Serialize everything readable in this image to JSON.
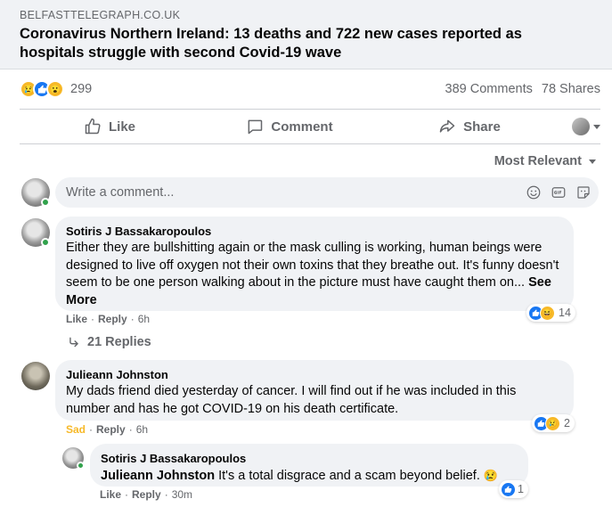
{
  "link": {
    "domain": "BELFASTTELEGRAPH.CO.UK",
    "title": "Coronavirus Northern Ireland: 13 deaths and 722 new cases reported as hospitals struggle with second Covid-19 wave"
  },
  "stats": {
    "reaction_count": "299",
    "comments": "389 Comments",
    "shares": "78 Shares"
  },
  "actions": {
    "like": "Like",
    "comment": "Comment",
    "share": "Share"
  },
  "sort": {
    "label": "Most Relevant"
  },
  "composer": {
    "placeholder": "Write a comment..."
  },
  "comments": [
    {
      "author": "Sotiris J Bassakaropoulos",
      "text": "Either they are bullshitting again or the mask culling is working, human beings were designed to live off oxygen not their own toxins that they breathe out. It's funny doesn't seem to be one person walking about in the picture must have caught them on...",
      "see_more": "See More",
      "like": "Like",
      "reply": "Reply",
      "time": "6h",
      "reaction_count": "14",
      "replies_label": "21 Replies"
    },
    {
      "author": "Julieann Johnston",
      "text": "My dads friend died yesterday of cancer. I will find out if he was included in this number and has he got COVID-19 on his death certificate.",
      "user_reaction": "Sad",
      "reply": "Reply",
      "time": "6h",
      "reaction_count": "2"
    },
    {
      "author": "Sotiris J Bassakaropoulos",
      "mention": "Julieann Johnston",
      "text": " It's a total disgrace and a scam beyond belief.",
      "like": "Like",
      "reply": "Reply",
      "time": "30m",
      "reaction_count": "1"
    }
  ],
  "colors": {
    "accent": "#1877f2",
    "sad": "#f7b928",
    "online": "#31a24c",
    "muted": "#65676b"
  }
}
